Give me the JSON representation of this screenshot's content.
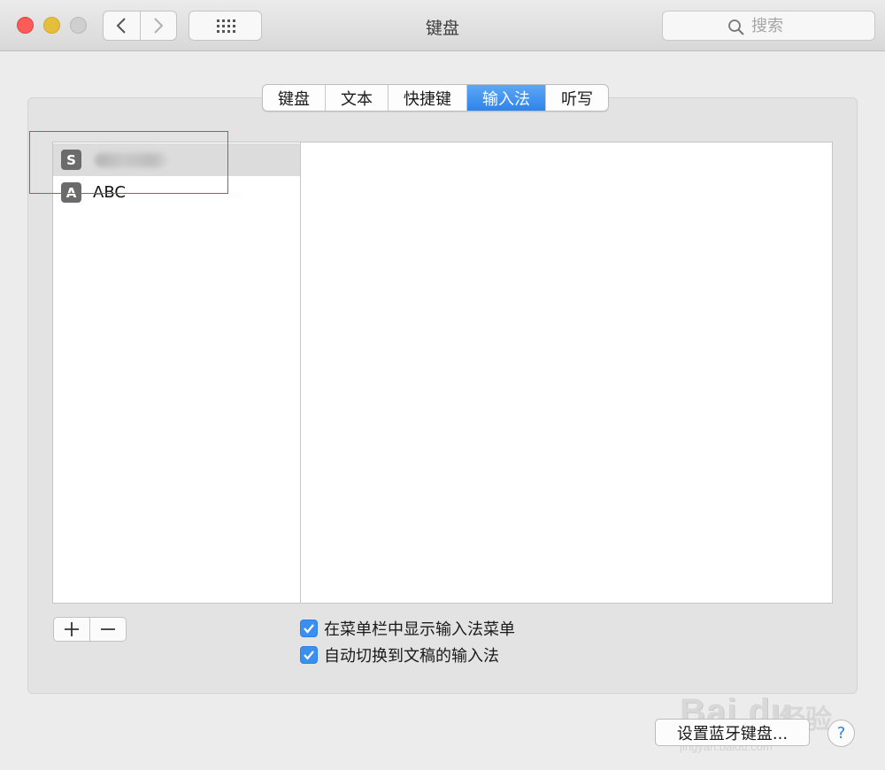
{
  "window": {
    "title": "键盘"
  },
  "toolbar": {
    "back_icon": "chevron-left-icon",
    "forward_icon": "chevron-right-icon",
    "grid_icon": "grid-icon"
  },
  "search": {
    "placeholder": "搜索",
    "icon": "search-icon"
  },
  "tabs": [
    {
      "label": "键盘",
      "active": false
    },
    {
      "label": "文本",
      "active": false
    },
    {
      "label": "快捷键",
      "active": false
    },
    {
      "label": "输入法",
      "active": true
    },
    {
      "label": "听写",
      "active": false
    }
  ],
  "input_methods": [
    {
      "icon_glyph": "S",
      "icon": "sogou-icon",
      "label": "",
      "selected": true
    },
    {
      "icon_glyph": "A",
      "icon": "abc-icon",
      "label": "ABC",
      "selected": false
    }
  ],
  "list_controls": {
    "add_icon": "plus-icon",
    "remove_icon": "minus-icon"
  },
  "options": [
    {
      "label": "在菜单栏中显示输入法菜单",
      "checked": true
    },
    {
      "label": "自动切换到文稿的输入法",
      "checked": true
    }
  ],
  "footer": {
    "bluetooth_label": "设置蓝牙键盘...",
    "help_label": "?"
  },
  "watermark": {
    "brand": "Bai du",
    "sub": "经验",
    "url": "jingyan.baidu.com"
  },
  "colors": {
    "accent": "#2f83ec",
    "highlight_box": "#d64545"
  }
}
